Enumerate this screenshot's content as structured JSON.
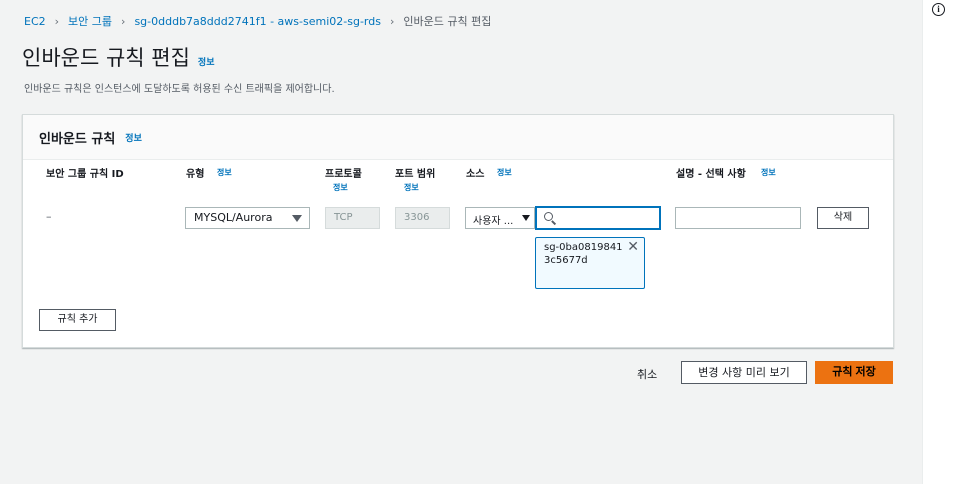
{
  "breadcrumb": {
    "items": [
      "EC2",
      "보안 그룹",
      "sg-0dddb7a8ddd2741f1 - aws-semi02-sg-rds"
    ],
    "current": "인바운드 규칙 편집"
  },
  "page": {
    "title": "인바운드 규칙 편집",
    "info_label": "정보",
    "description": "인바운드 규칙은 인스턴스에 도달하도록 허용된 수신 트래픽을 제어합니다."
  },
  "panel": {
    "title": "인바운드 규칙",
    "info_label": "정보",
    "columns": {
      "rule_id": "보안 그룹 규칙 ID",
      "type": "유형",
      "protocol": "프로토콜",
      "port_range": "포트 범위",
      "source": "소스",
      "description": "설명 - 선택 사항"
    },
    "col_info_label": "정보",
    "row": {
      "rule_id": "–",
      "type": "MYSQL/Aurora",
      "protocol": "TCP",
      "port_range": "3306",
      "source_type": "사용자 ...",
      "source_search_value": "",
      "source_token": "sg-0ba08198413c5677d",
      "description_value": "",
      "delete_label": "삭제"
    },
    "add_rule_label": "규칙 추가"
  },
  "footer": {
    "cancel_label": "취소",
    "preview_label": "변경 사항 미리 보기",
    "save_label": "규칙 저장"
  },
  "rail": {
    "info_icon": "info-icon",
    "info_glyph": "i"
  },
  "colors": {
    "link": "#0073bb",
    "primary_button": "#ec7211"
  }
}
